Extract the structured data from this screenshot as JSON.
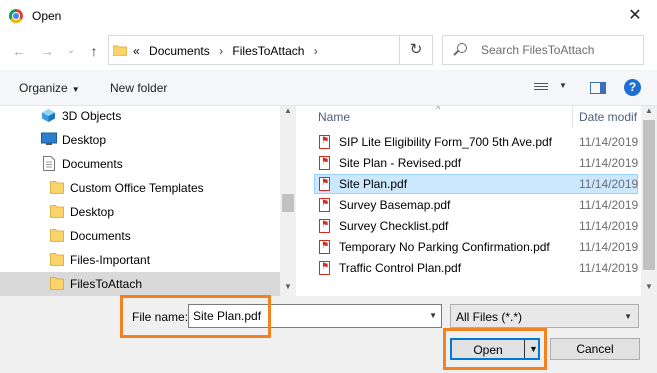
{
  "window": {
    "title": "Open",
    "close_glyph": "✕"
  },
  "nav": {
    "back_glyph": "←",
    "forward_glyph": "→",
    "recent_glyph": "⌄",
    "up_glyph": "↑",
    "breadcrumb_overflow": "«",
    "breadcrumbs": [
      "Documents",
      "FilesToAttach"
    ],
    "breadcrumb_separator": "›",
    "refresh_glyph": "↻",
    "search_placeholder": "Search FilesToAttach"
  },
  "toolbar": {
    "organize_label": "Organize",
    "new_folder_label": "New folder",
    "help_glyph": "?"
  },
  "sidebar": {
    "items": [
      {
        "label": "3D Objects",
        "icon": "cube-icon"
      },
      {
        "label": "Desktop",
        "icon": "desktop-icon"
      },
      {
        "label": "Documents",
        "icon": "documents-icon"
      },
      {
        "label": "Custom Office Templates",
        "icon": "folder-icon"
      },
      {
        "label": "Desktop",
        "icon": "folder-icon"
      },
      {
        "label": "Documents",
        "icon": "folder-icon"
      },
      {
        "label": "Files-Important",
        "icon": "folder-icon"
      },
      {
        "label": "FilesToAttach",
        "icon": "folder-icon",
        "selected": true
      }
    ]
  },
  "columns": {
    "name": "Name",
    "date": "Date modif"
  },
  "files": [
    {
      "name": "SIP Lite Eligibility Form_700 5th Ave.pdf",
      "date": "11/14/2019"
    },
    {
      "name": "Site Plan - Revised.pdf",
      "date": "11/14/2019"
    },
    {
      "name": "Site Plan.pdf",
      "date": "11/14/2019",
      "selected": true
    },
    {
      "name": "Survey Basemap.pdf",
      "date": "11/14/2019"
    },
    {
      "name": "Survey Checklist.pdf",
      "date": "11/14/2019"
    },
    {
      "name": "Temporary No Parking Confirmation.pdf",
      "date": "11/14/2019"
    },
    {
      "name": "Traffic Control Plan.pdf",
      "date": "11/14/2019"
    }
  ],
  "footer": {
    "file_name_label": "File name:",
    "file_name_value": "Site Plan.pdf",
    "file_type_value": "All Files (*.*)",
    "open_label": "Open",
    "cancel_label": "Cancel"
  },
  "colors": {
    "highlight": "#f58220",
    "selection": "#cce8ff",
    "accent": "#0078d7",
    "pdf": "#d52b1e"
  }
}
